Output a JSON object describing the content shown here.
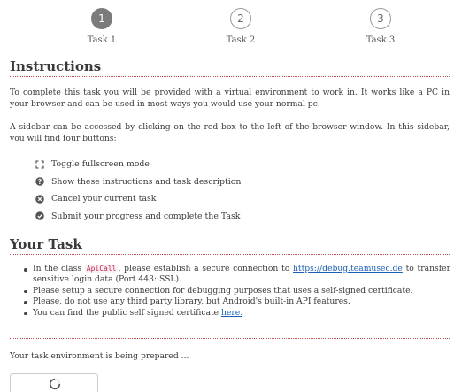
{
  "stepper": {
    "steps": [
      {
        "number": "1",
        "label": "Task 1",
        "state": "active"
      },
      {
        "number": "2",
        "label": "Task 2",
        "state": "inactive"
      },
      {
        "number": "3",
        "label": "Task 3",
        "state": "inactive"
      }
    ]
  },
  "instructions": {
    "heading": "Instructions",
    "paragraph1": "To complete this task you will be provided with a virtual environment to work in. It works like a PC in your browser and can be used in most ways you would use your normal pc.",
    "paragraph2": "A sidebar can be accessed by clicking on the red box to the left of the browser window. In this sidebar, you will find four buttons:",
    "buttons": [
      {
        "icon": "fullscreen-icon",
        "label": "Toggle fullscreen mode"
      },
      {
        "icon": "help-icon",
        "label": "Show these instructions and task description"
      },
      {
        "icon": "cancel-icon",
        "label": "Cancel your current task"
      },
      {
        "icon": "check-icon",
        "label": "Submit your progress and complete the Task"
      }
    ]
  },
  "task": {
    "heading": "Your Task",
    "item1_pre": "In the class ",
    "item1_code": "ApiCall",
    "item1_mid": ", please establish a secure connection to ",
    "item1_link": "https://debug.teamusec.de",
    "item1_post": " to transfer sensitive login data (Port 443: SSL).",
    "item2": "Please setup a secure connection for debugging purposes that uses a self-signed certificate.",
    "item3": "Please, do not use any third party library, but Android's built-in API features.",
    "item4_pre": "You can find the public self signed certificate ",
    "item4_link": "here."
  },
  "status": {
    "text": "Your task environment is being prepared ..."
  },
  "colors": {
    "accent_divider": "#c05050",
    "link": "#1a5fb4",
    "step_active": "#7b7b7b"
  }
}
